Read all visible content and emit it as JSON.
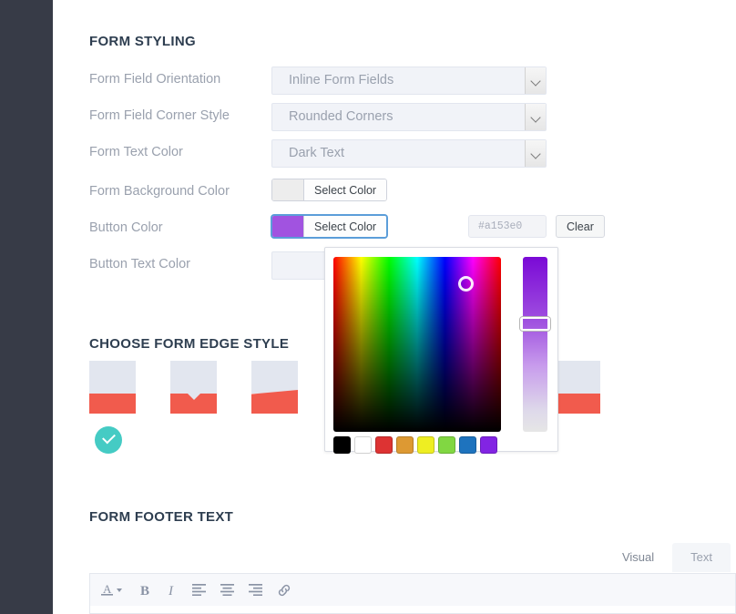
{
  "sections": {
    "form_styling": "FORM STYLING",
    "edge_style": "CHOOSE FORM EDGE STYLE",
    "footer_text": "FORM FOOTER TEXT"
  },
  "styling_rows": [
    {
      "label": "Form Field Orientation",
      "value": "Inline Form Fields",
      "control": "select"
    },
    {
      "label": "Form Field Corner Style",
      "value": "Rounded Corners",
      "control": "select"
    },
    {
      "label": "Form Text Color",
      "value": "Dark Text",
      "control": "select"
    },
    {
      "label": "Form Background Color",
      "value": "Select Color",
      "control": "color",
      "swatch": "#ededed"
    },
    {
      "label": "Button Color",
      "value": "Select Color",
      "control": "color",
      "swatch": "#a153e0"
    },
    {
      "label": "Button Text Color",
      "value": "",
      "control": "select"
    }
  ],
  "button_color": {
    "select_label": "Select Color",
    "hex_placeholder": "#a153e0",
    "clear_label": "Clear",
    "current": "#a153e0",
    "focus_ring": "#5b9dd9"
  },
  "picker": {
    "swatches": [
      "#000000",
      "#ffffff",
      "#dd3333",
      "#dd9933",
      "#eeee22",
      "#81d742",
      "#1e73be",
      "#8224e3"
    ],
    "hue_top": "#7a09d6",
    "hue_bottom": "#e6e6e6"
  },
  "edge_styles": {
    "items": [
      {
        "name": "flat",
        "selected": true
      },
      {
        "name": "notch",
        "selected": false
      },
      {
        "name": "slant",
        "selected": false
      },
      {
        "name": "flat-2",
        "selected": false
      }
    ],
    "top_color": "#e2e6ef",
    "bottom_color": "#f15b4d",
    "check_color": "#45cbc4"
  },
  "editor": {
    "tabs": [
      {
        "label": "Visual",
        "active": true
      },
      {
        "label": "Text",
        "active": false
      }
    ],
    "toolbar": [
      {
        "name": "text-color-icon",
        "glyph": "A"
      },
      {
        "name": "bold-icon",
        "glyph": "B"
      },
      {
        "name": "italic-icon",
        "glyph": "I"
      },
      {
        "name": "align-left-icon",
        "glyph": ""
      },
      {
        "name": "align-center-icon",
        "glyph": ""
      },
      {
        "name": "align-right-icon",
        "glyph": ""
      },
      {
        "name": "link-icon",
        "glyph": "ὑ7"
      }
    ]
  },
  "theme": {
    "sidebar_bg": "#373b47",
    "heading_color": "#2e3e50",
    "label_color": "#9aa1ae",
    "field_bg": "#f1f3f8"
  }
}
